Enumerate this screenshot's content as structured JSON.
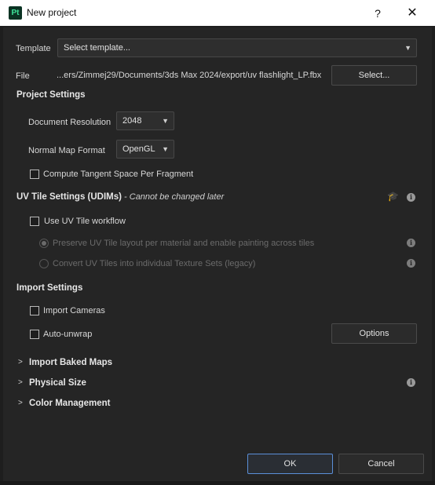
{
  "window": {
    "title": "New project",
    "app_icon_text": "Pt",
    "help_label": "?",
    "close_label": "✕"
  },
  "template": {
    "label": "Template",
    "value": "Select template..."
  },
  "file": {
    "label": "File",
    "path": "...ers/Zimmej29/Documents/3ds Max 2024/export/uv flashlight_LP.fbx",
    "select_label": "Select..."
  },
  "project_settings": {
    "heading": "Project Settings",
    "doc_res_label": "Document Resolution",
    "doc_res_value": "2048",
    "normal_map_label": "Normal Map Format",
    "normal_map_value": "OpenGL",
    "compute_tangent_label": "Compute Tangent Space Per Fragment"
  },
  "uv_tile": {
    "heading": "UV Tile Settings (UDIMs)",
    "note": "- Cannot be changed later",
    "use_uv_label": "Use UV Tile workflow",
    "preserve_label": "Preserve UV Tile layout per material and enable painting across tiles",
    "convert_label": "Convert UV Tiles into individual Texture Sets (legacy)"
  },
  "import_settings": {
    "heading": "Import Settings",
    "cameras_label": "Import Cameras",
    "auto_unwrap_label": "Auto-unwrap",
    "options_label": "Options"
  },
  "collapsibles": {
    "baked_maps": "Import Baked Maps",
    "physical_size": "Physical Size",
    "color_management": "Color Management"
  },
  "footer": {
    "ok_label": "OK",
    "cancel_label": "Cancel"
  },
  "icons": {
    "info": "info-icon",
    "learn": "graduation-cap-icon",
    "chevron": "chevron-down-icon",
    "expand": "chevron-right-icon"
  },
  "colors": {
    "accent": "#5b8fd8",
    "app_icon_bg": "#0b3323",
    "app_icon_fg": "#3fe39a"
  }
}
